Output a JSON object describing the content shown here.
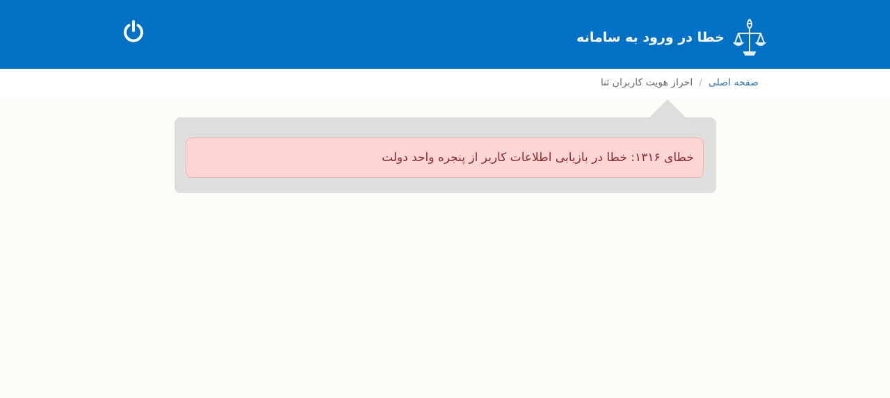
{
  "header": {
    "title": "خطا در ورود به سامانه",
    "logout_icon": "power-icon",
    "emblem_icon": "scales-of-justice-emblem"
  },
  "breadcrumb": {
    "home": "صفحه اصلی",
    "separator": "/",
    "current": "احراز هویت کاربران ثنا"
  },
  "alert": {
    "message": "خطای ۱۳۱۶: خطا در بازیابی اطلاعات کاربر از پنجره واحد دولت"
  },
  "colors": {
    "header_bg": "#0071c5",
    "page_bg": "#fdfbf6",
    "panel_bg": "#dedede",
    "alert_bg": "#fdd5d5",
    "alert_text": "#8a2a2a",
    "link": "#337ab7"
  }
}
